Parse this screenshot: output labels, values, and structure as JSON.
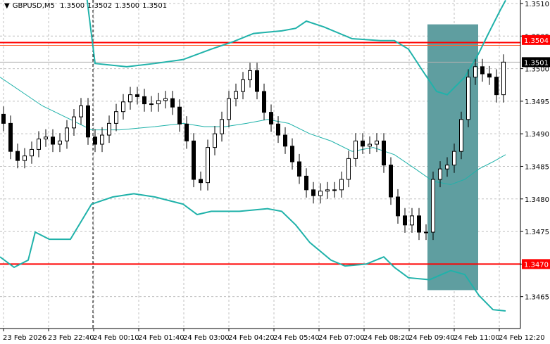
{
  "header": {
    "menu_icon": "triangle-down-icon",
    "symbol": "GBPUSD,M5",
    "open": "1.3500",
    "high": "1.3502",
    "low": "1.3500",
    "close": "1.3501"
  },
  "colors": {
    "background": "#ffffff",
    "grid": "#c0c0c0",
    "candle": "#000000",
    "band": "#20b2aa",
    "level_line": "#ff0000",
    "highlight_box": "#5f9ea0",
    "current_price_label_bg": "#000000"
  },
  "chart_data": {
    "type": "candlestick",
    "title": "GBPUSD,M5",
    "ylim": [
      1.3461,
      1.3512
    ],
    "y_ticks": [
      "1.3510",
      "1.3505",
      "1.3500",
      "1.3495",
      "1.3490",
      "1.3485",
      "1.3480",
      "1.3475",
      "1.3470",
      "1.3465"
    ],
    "x_labels": [
      "23 Feb 2026",
      "23 Feb 22:40",
      "24 Feb 00:10",
      "24 Feb 01:40",
      "24 Feb 03:00",
      "24 Feb 04:20",
      "24 Feb 05:40",
      "24 Feb 07:00",
      "24 Feb 08:20",
      "24 Feb 09:40",
      "24 Feb 11:00",
      "24 Feb 12:20"
    ],
    "grid": true,
    "wick_extension": 0.00012,
    "first_open": 1.3493,
    "closes": [
      1.34916,
      1.34873,
      1.34859,
      1.34866,
      1.34876,
      1.34892,
      1.34895,
      1.34884,
      1.34889,
      1.34909,
      1.34926,
      1.34943,
      1.34895,
      1.34884,
      1.34898,
      1.34916,
      1.34934,
      1.34949,
      1.3496,
      1.34957,
      1.34946,
      1.34946,
      1.34951,
      1.34954,
      1.34941,
      1.34915,
      1.34889,
      1.3483,
      1.34825,
      1.34879,
      1.349,
      1.34922,
      1.34954,
      1.34965,
      1.34983,
      1.34997,
      1.34965,
      1.34933,
      1.34915,
      1.34898,
      1.34881,
      1.34857,
      1.34835,
      1.34814,
      1.34805,
      1.34812,
      1.34814,
      1.34814,
      1.3483,
      1.34862,
      1.34889,
      1.34881,
      1.34884,
      1.34889,
      1.34852,
      1.34803,
      1.34774,
      1.3476,
      1.34774,
      1.34749,
      1.34749,
      1.3483,
      1.34846,
      1.34852,
      1.34873,
      1.34922,
      1.34987,
      1.35003,
      1.34992,
      1.34987,
      1.3496,
      1.3501
    ],
    "bollinger": {
      "upper": [
        [
          11.3,
          1.35155
        ],
        [
          13,
          1.35008
        ],
        [
          17.5,
          1.35003
        ],
        [
          21.5,
          1.35008
        ],
        [
          25.5,
          1.35014
        ],
        [
          29.5,
          1.3503
        ],
        [
          32.5,
          1.35041
        ],
        [
          35.5,
          1.35054
        ],
        [
          39.5,
          1.35058
        ],
        [
          41.5,
          1.35062
        ],
        [
          43,
          1.35073
        ],
        [
          45.5,
          1.35064
        ],
        [
          49.5,
          1.35046
        ],
        [
          53.5,
          1.35043
        ],
        [
          55.5,
          1.35043
        ],
        [
          57.5,
          1.3503
        ],
        [
          59.5,
          1.34997
        ],
        [
          61.5,
          1.34965
        ],
        [
          63,
          1.3496
        ],
        [
          65.5,
          1.34987
        ],
        [
          67.5,
          1.35024
        ],
        [
          69,
          1.35057
        ],
        [
          70.5,
          1.35089
        ],
        [
          71.3,
          1.35105
        ]
      ],
      "middle": [
        [
          -0.5,
          1.34987
        ],
        [
          2.5,
          1.34965
        ],
        [
          5.5,
          1.34943
        ],
        [
          9.5,
          1.34922
        ],
        [
          12.5,
          1.34906
        ],
        [
          16.5,
          1.34906
        ],
        [
          21.5,
          1.34911
        ],
        [
          25.5,
          1.34916
        ],
        [
          28.5,
          1.34911
        ],
        [
          31.5,
          1.34911
        ],
        [
          34.5,
          1.34916
        ],
        [
          37.5,
          1.34922
        ],
        [
          40.5,
          1.34916
        ],
        [
          43.5,
          1.349
        ],
        [
          46.5,
          1.34889
        ],
        [
          49.5,
          1.34873
        ],
        [
          52.5,
          1.34879
        ],
        [
          55.5,
          1.34868
        ],
        [
          58.5,
          1.34846
        ],
        [
          61,
          1.34827
        ],
        [
          63.5,
          1.34822
        ],
        [
          65.5,
          1.3483
        ],
        [
          67.5,
          1.34846
        ],
        [
          69.5,
          1.34857
        ],
        [
          71.3,
          1.34868
        ]
      ],
      "lower": [
        [
          -0.5,
          1.34711
        ],
        [
          1.5,
          1.34695
        ],
        [
          3.5,
          1.34706
        ],
        [
          4.5,
          1.34749
        ],
        [
          6.5,
          1.34738
        ],
        [
          9.5,
          1.34738
        ],
        [
          12.5,
          1.34792
        ],
        [
          15.5,
          1.34803
        ],
        [
          18.5,
          1.34808
        ],
        [
          21.5,
          1.34803
        ],
        [
          25.5,
          1.34792
        ],
        [
          27.5,
          1.34776
        ],
        [
          29.5,
          1.34781
        ],
        [
          33.5,
          1.34781
        ],
        [
          37.5,
          1.34785
        ],
        [
          39.5,
          1.34781
        ],
        [
          41.5,
          1.3476
        ],
        [
          43.5,
          1.34733
        ],
        [
          46.5,
          1.34706
        ],
        [
          48.5,
          1.34697
        ],
        [
          51.5,
          1.347
        ],
        [
          54,
          1.34711
        ],
        [
          55.5,
          1.34695
        ],
        [
          57.5,
          1.34679
        ],
        [
          60.5,
          1.34676
        ],
        [
          63.5,
          1.3469
        ],
        [
          65.5,
          1.34684
        ],
        [
          67.5,
          1.34652
        ],
        [
          69.5,
          1.3463
        ],
        [
          71.3,
          1.34628
        ]
      ]
    },
    "levels": [
      {
        "price": 1.3504,
        "label": "1.3504"
      },
      {
        "price": 1.347,
        "label": "1.3470"
      }
    ],
    "current_price": {
      "price": 1.3501,
      "label": "1.3501"
    },
    "highlight_zone": {
      "from_bar": 60.2,
      "to_bar": 67.4,
      "price_high": 1.35068,
      "price_low": 1.3466
    },
    "day_separator_bar": 12.7
  }
}
